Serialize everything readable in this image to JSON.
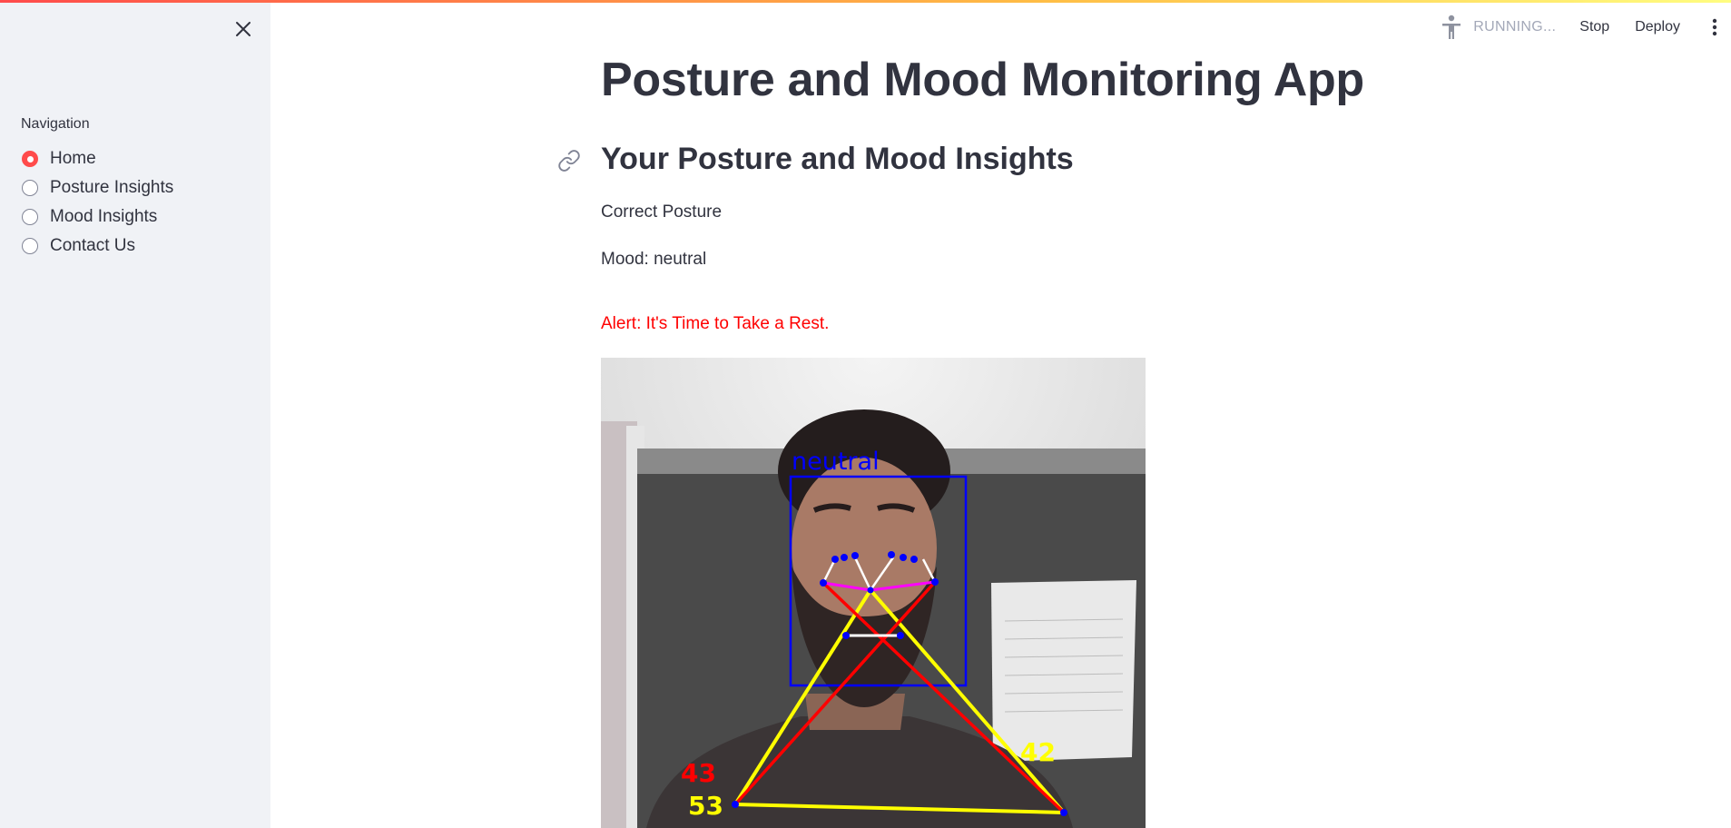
{
  "sidebar": {
    "nav_label": "Navigation",
    "items": [
      {
        "label": "Home",
        "selected": true
      },
      {
        "label": "Posture Insights",
        "selected": false
      },
      {
        "label": "Mood Insights",
        "selected": false
      },
      {
        "label": "Contact Us",
        "selected": false
      }
    ],
    "close_icon": "close-icon"
  },
  "header": {
    "status_text": "RUNNING...",
    "stop_label": "Stop",
    "deploy_label": "Deploy",
    "status_icon": "running-man-icon",
    "menu_icon": "kebab-menu-icon"
  },
  "main": {
    "title": "Posture and Mood Monitoring App",
    "subheader": "Your Posture and Mood Insights",
    "posture_status": "Correct Posture",
    "mood_status": "Mood: neutral",
    "alert": "Alert: It's Time to Take a Rest."
  },
  "webcam": {
    "emotion_label": "neutral",
    "angle_left_red": "43",
    "angle_left_yellow": "53",
    "angle_right_yellow": "42"
  },
  "colors": {
    "accent": "#ff4b4b",
    "sidebar_bg": "#f0f2f6",
    "text": "#31333f",
    "alert": "#ff0000",
    "face_box": "#0000ff",
    "yellow_line": "#ffff00",
    "red_line": "#ff0000",
    "magenta_line": "#ff00ff"
  }
}
